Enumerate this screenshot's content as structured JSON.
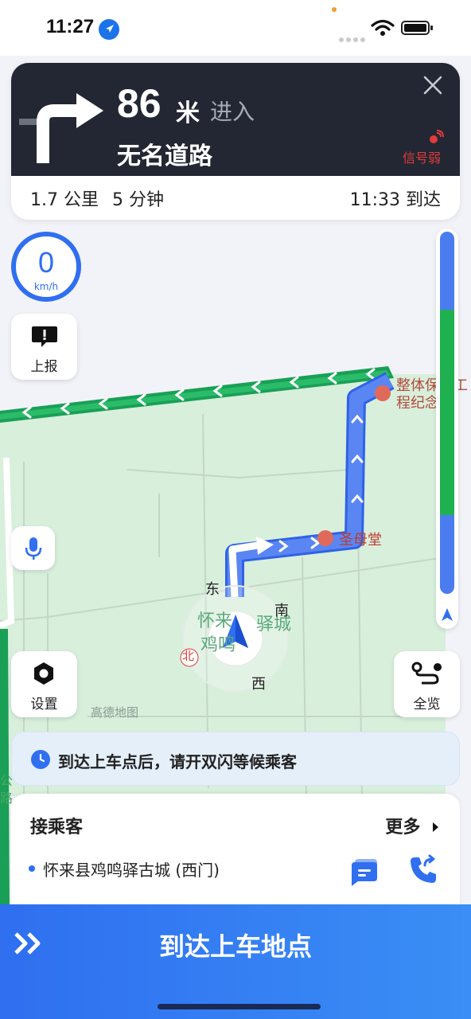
{
  "status_bar": {
    "time": "11:27"
  },
  "nav": {
    "distance_value": "86",
    "distance_unit": "米",
    "action": "进入",
    "road_name": "无名道路",
    "signal_status": "信号弱",
    "remaining_distance": "1.7 公里",
    "remaining_time": "5 分钟",
    "arrival": "11:33 到达"
  },
  "speed": {
    "value": "0",
    "unit": "km/h"
  },
  "buttons": {
    "report": "上报",
    "settings": "设置",
    "overview": "全览"
  },
  "map": {
    "poi_church": "圣母堂",
    "poi_memorial_line1": "整体保护工",
    "poi_memorial_line2": "程纪念碑",
    "area_label": [
      "怀来",
      "鸡鸣",
      "驿城"
    ],
    "compass": {
      "east": "东",
      "south": "南",
      "west": "西",
      "north": "北"
    },
    "watermark": "高德地图",
    "road_label": "公路"
  },
  "tip": {
    "text": "到达上车点后，请开双闪等候乘客"
  },
  "passenger": {
    "title": "接乘客",
    "more": "更多",
    "pickup_location": "怀来县鸡鸣驿古城 (西门)"
  },
  "arrive_button": {
    "label": "到达上车地点"
  },
  "colors": {
    "accent": "#2f6ff0",
    "nav_dark": "#232733",
    "traffic_green": "#1aa260",
    "route_blue": "#4a7cf0",
    "warning_red": "#e23b3b"
  }
}
